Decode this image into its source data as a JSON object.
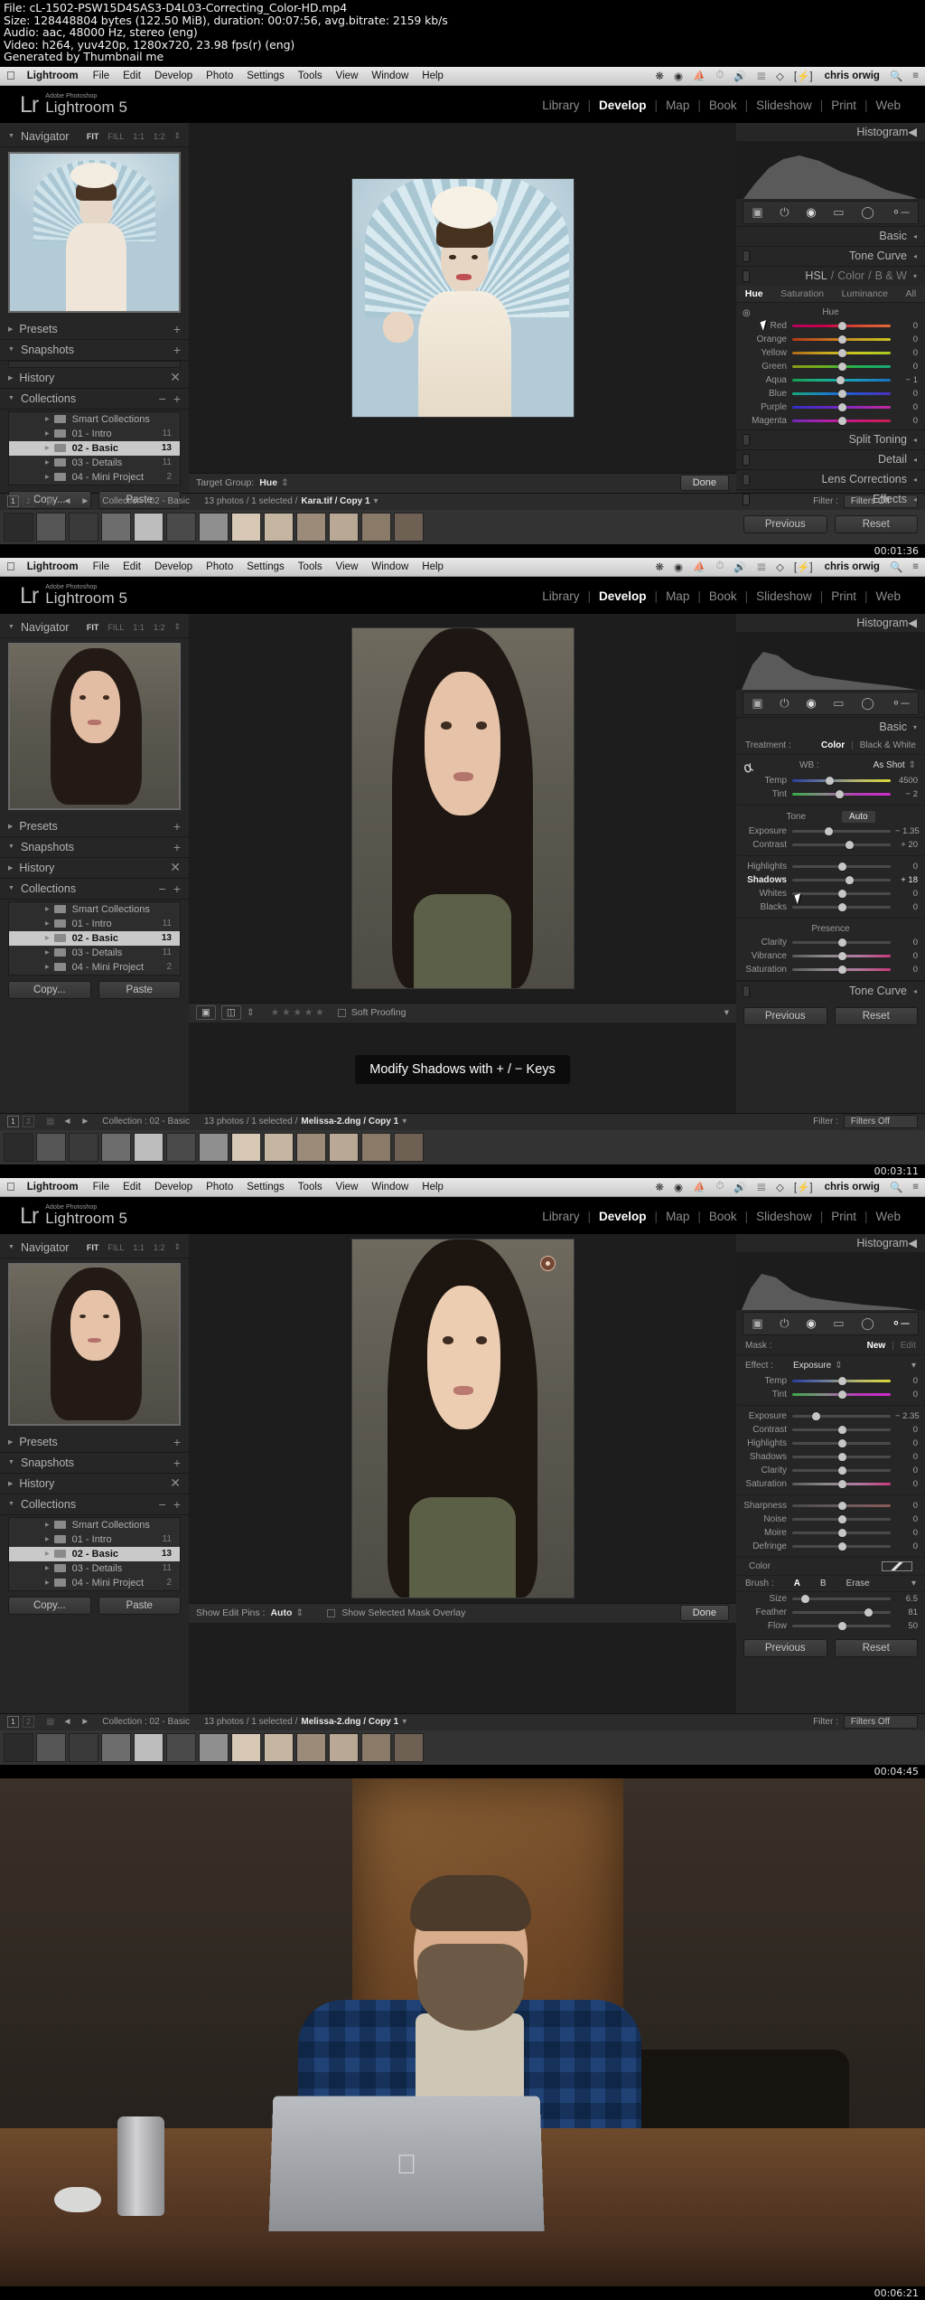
{
  "fileinfo": {
    "line1": "File: cL-1502-PSW15D4SAS3-D4L03-Correcting_Color-HD.mp4",
    "line2": "Size: 128448804 bytes (122.50 MiB), duration: 00:07:56, avg.bitrate: 2159 kb/s",
    "line3": "Audio: aac, 48000 Hz, stereo (eng)",
    "line4": "Video: h264, yuv420p, 1280x720, 23.98 fps(r) (eng)",
    "line5": "Generated by Thumbnail me"
  },
  "menubar": {
    "apple": "",
    "items": [
      "Lightroom",
      "File",
      "Edit",
      "Develop",
      "Photo",
      "Settings",
      "Tools",
      "View",
      "Window",
      "Help"
    ],
    "user": "chris orwig",
    "icons": [
      "bluetooth-icon",
      "wifi-icon",
      "battery-icon",
      "search-icon",
      "notification-icon"
    ]
  },
  "app": {
    "logo_mark": "Lr",
    "brand_small": "Adobe Photoshop",
    "brand_name": "Lightroom 5",
    "modules": [
      "Library",
      "Develop",
      "Map",
      "Book",
      "Slideshow",
      "Print",
      "Web"
    ],
    "active_module": "Develop"
  },
  "left_panel": {
    "navigator": {
      "title": "Navigator",
      "zoom_levels": [
        "FIT",
        "FILL",
        "1:1",
        "1:2"
      ],
      "active_zoom": "FIT"
    },
    "presets": "Presets",
    "snapshots": "Snapshots",
    "history": "History",
    "collections": "Collections",
    "collection_rows": [
      {
        "name": "Smart Collections",
        "count": ""
      },
      {
        "name": "01 - Intro",
        "count": "11"
      },
      {
        "name": "02 - Basic",
        "count": "13"
      },
      {
        "name": "03 - Details",
        "count": "11"
      },
      {
        "name": "04 - Mini Project",
        "count": "2"
      }
    ],
    "copy_label": "Copy...",
    "paste_label": "Paste"
  },
  "right_panel": {
    "histogram": "Histogram",
    "previous_label": "Previous",
    "reset_label": "Reset"
  },
  "shot1": {
    "sections": [
      "Basic",
      "Tone Curve"
    ],
    "hsl_header": {
      "hsl": "HSL",
      "color": "Color",
      "bw": "B & W"
    },
    "subtabs": [
      "Hue",
      "Saturation",
      "Luminance",
      "All"
    ],
    "active_subtab": "Hue",
    "group_title": "Hue",
    "sliders": [
      {
        "label": "Red",
        "value": "0",
        "pos": 50
      },
      {
        "label": "Orange",
        "value": "0",
        "pos": 50
      },
      {
        "label": "Yellow",
        "value": "0",
        "pos": 50
      },
      {
        "label": "Green",
        "value": "0",
        "pos": 50
      },
      {
        "label": "Aqua",
        "value": "− 1",
        "pos": 49
      },
      {
        "label": "Blue",
        "value": "0",
        "pos": 50
      },
      {
        "label": "Purple",
        "value": "0",
        "pos": 50
      },
      {
        "label": "Magenta",
        "value": "0",
        "pos": 50
      }
    ],
    "lower_sections": [
      "Split Toning",
      "Detail",
      "Lens Corrections",
      "Effects"
    ],
    "toolbar": {
      "label": "Target Group:",
      "value": "Hue",
      "done": "Done"
    },
    "filmstrip": {
      "collection": "Collection : 02 - Basic",
      "photos": "13 photos / 1 selected /",
      "file": "Kara.tif / Copy 1",
      "filter_label": "Filter :",
      "filter_value": "Filters Off"
    },
    "timestamp": "00:01:36"
  },
  "shot2": {
    "basic_title": "Basic",
    "treatment_label": "Treatment :",
    "treatment_color": "Color",
    "treatment_bw": "Black & White",
    "wb_label": "WB :",
    "wb_value": "As Shot",
    "wb_sliders": [
      {
        "label": "Temp",
        "value": "4500",
        "pos": 38
      },
      {
        "label": "Tint",
        "value": "− 2",
        "pos": 48
      }
    ],
    "tone_title": "Tone",
    "auto_label": "Auto",
    "tone_sliders": [
      {
        "label": "Exposure",
        "value": "− 1.35",
        "pos": 37
      },
      {
        "label": "Contrast",
        "value": "+ 20",
        "pos": 58
      }
    ],
    "light_sliders": [
      {
        "label": "Highlights",
        "value": "0",
        "pos": 50
      },
      {
        "label": "Shadows",
        "value": "+ 18",
        "pos": 58,
        "active": true
      },
      {
        "label": "Whites",
        "value": "0",
        "pos": 50
      },
      {
        "label": "Blacks",
        "value": "0",
        "pos": 50
      }
    ],
    "presence_title": "Presence",
    "presence_sliders": [
      {
        "label": "Clarity",
        "value": "0",
        "pos": 50
      },
      {
        "label": "Vibrance",
        "value": "0",
        "pos": 50
      },
      {
        "label": "Saturation",
        "value": "0",
        "pos": 50
      }
    ],
    "tone_curve": "Tone Curve",
    "tooltip": "Modify Shadows with + / − Keys",
    "toolbar": {
      "soft_proofing": "Soft Proofing",
      "stars": "★★★★★"
    },
    "filmstrip": {
      "collection": "Collection : 02 - Basic",
      "photos": "13 photos / 1 selected /",
      "file": "Melissa-2.dng / Copy 1",
      "filter_label": "Filter :",
      "filter_value": "Filters Off"
    },
    "timestamp": "00:03:11"
  },
  "shot3": {
    "mask_label": "Mask :",
    "mask_new": "New",
    "mask_edit": "Edit",
    "effect_label": "Effect :",
    "effect_value": "Exposure",
    "wb_sliders": [
      {
        "label": "Temp",
        "value": "0",
        "pos": 50
      },
      {
        "label": "Tint",
        "value": "0",
        "pos": 50
      }
    ],
    "main_sliders": [
      {
        "label": "Exposure",
        "value": "− 2.35",
        "pos": 24
      },
      {
        "label": "Contrast",
        "value": "0",
        "pos": 50
      },
      {
        "label": "Highlights",
        "value": "0",
        "pos": 50
      },
      {
        "label": "Shadows",
        "value": "0",
        "pos": 50
      },
      {
        "label": "Clarity",
        "value": "0",
        "pos": 50
      },
      {
        "label": "Saturation",
        "value": "0",
        "pos": 50
      }
    ],
    "detail_sliders": [
      {
        "label": "Sharpness",
        "value": "0",
        "pos": 50
      },
      {
        "label": "Noise",
        "value": "0",
        "pos": 50
      },
      {
        "label": "Moire",
        "value": "0",
        "pos": 50
      },
      {
        "label": "Defringe",
        "value": "0",
        "pos": 50
      }
    ],
    "color_label": "Color",
    "brush_label": "Brush :",
    "brush_a": "A",
    "brush_b": "B",
    "brush_erase": "Erase",
    "brush_sliders": [
      {
        "label": "Size",
        "value": "6.5",
        "pos": 13
      },
      {
        "label": "Feather",
        "value": "81",
        "pos": 77
      },
      {
        "label": "Flow",
        "value": "50",
        "pos": 50
      }
    ],
    "toolbar": {
      "pins_label": "Show Edit Pins :",
      "pins_value": "Auto",
      "overlay_label": "Show Selected Mask Overlay",
      "done": "Done"
    },
    "filmstrip": {
      "collection": "Collection : 02 - Basic",
      "photos": "13 photos / 1 selected /",
      "file": "Melissa-2.dng / Copy 1",
      "filter_label": "Filter :",
      "filter_value": "Filters Off"
    },
    "timestamp": "00:04:45"
  },
  "shot4": {
    "timestamp": "00:06:21"
  },
  "colors": {
    "panel_bg": "#262626",
    "canvas_bg": "#1d1d1d",
    "accent_text": "#ffffff",
    "muted_text": "#9a9a9a"
  }
}
